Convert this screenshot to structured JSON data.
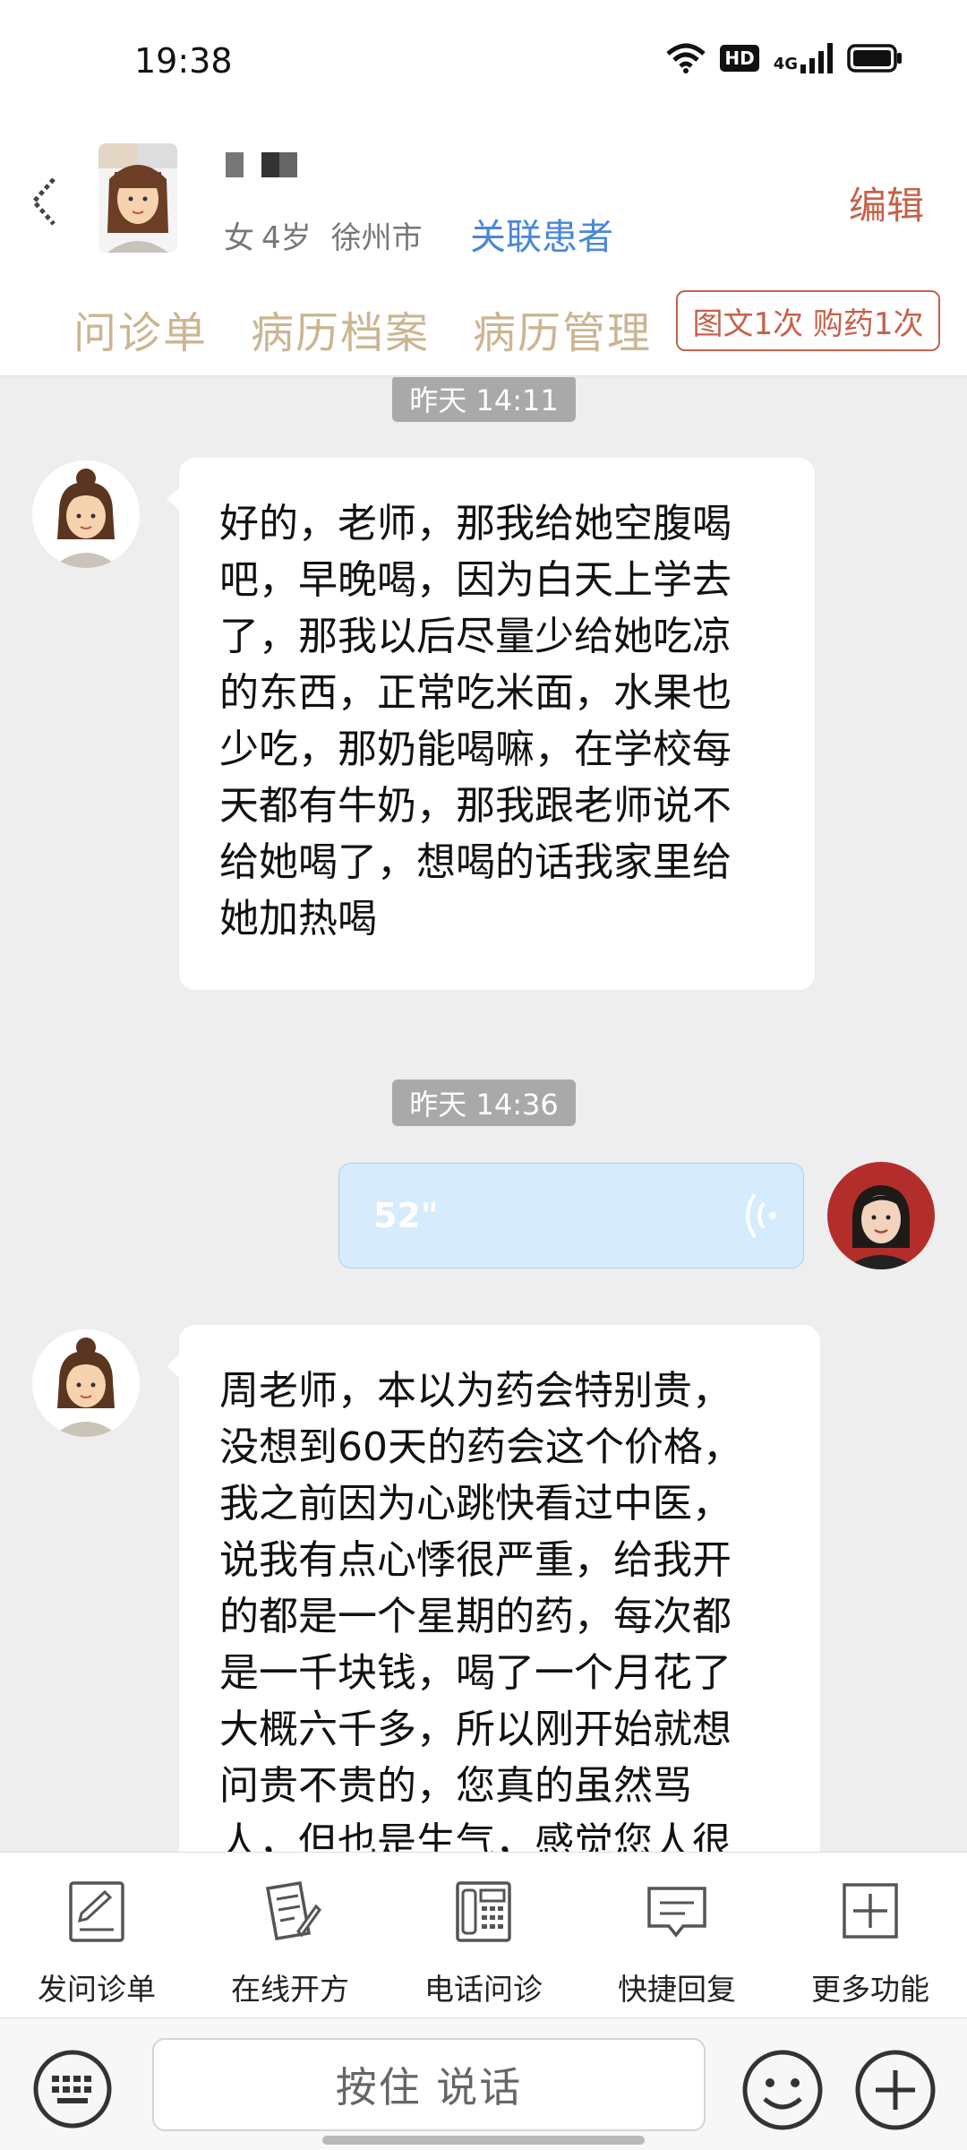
{
  "status_bar": {
    "time": "19:38",
    "hd_label": "HD",
    "network_label": "4G"
  },
  "header": {
    "patient_info": [
      "女",
      "4岁",
      "徐州市"
    ],
    "link_patient": "关联患者",
    "edit": "编辑",
    "tabs": [
      "问诊单",
      "病历档案",
      "病历管理"
    ],
    "service_badge": "图文1次 购药1次"
  },
  "chat": {
    "timestamps": [
      "昨天 14:11",
      "昨天 14:36"
    ],
    "messages": [
      {
        "sender": "patient",
        "lines": [
          "好的，老师，那我给她空腹喝",
          "吧，早晚喝，因为白天上学去",
          "了，那我以后尽量少给她吃凉",
          "的东西，正常吃米面，水果也",
          "少吃，那奶能喝嘛，在学校每",
          "天都有牛奶，那我跟老师说不",
          "给她喝了，想喝的话我家里给",
          "她加热喝"
        ]
      },
      {
        "sender": "doctor",
        "type": "voice",
        "duration": "52\""
      },
      {
        "sender": "patient",
        "lines": [
          "周老师，本以为药会特别贵，",
          "没想到60天的药会这个价格，",
          "我之前因为心跳快看过中医，",
          "说我有点心悸很严重，给我开",
          "的都是一个星期的药，每次都",
          "是一千块钱，喝了一个月花了",
          "大概六千多，所以刚开始就想",
          "问贵不贵的，您真的虽然骂",
          "人，但也是生气，感觉您人很"
        ]
      }
    ]
  },
  "toolbar": {
    "items": [
      {
        "label": "发问诊单",
        "icon": "form-icon"
      },
      {
        "label": "在线开方",
        "icon": "prescription-icon"
      },
      {
        "label": "电话问诊",
        "icon": "phone-icon"
      },
      {
        "label": "快捷回复",
        "icon": "chat-icon"
      },
      {
        "label": "更多功能",
        "icon": "plus-box-icon"
      }
    ]
  },
  "input": {
    "talk_label": "按住 说话"
  }
}
